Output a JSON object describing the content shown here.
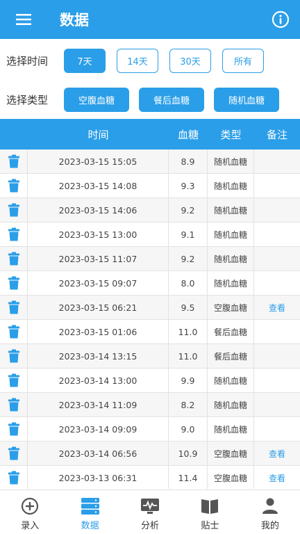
{
  "header": {
    "title": "数据"
  },
  "filters": {
    "time_label": "选择时间",
    "time_options": [
      "7天",
      "14天",
      "30天",
      "所有"
    ],
    "type_label": "选择类型",
    "type_options": [
      "空腹血糖",
      "餐后血糖",
      "随机血糖"
    ]
  },
  "table": {
    "columns": [
      "时间",
      "血糖",
      "类型",
      "备注"
    ],
    "rows": [
      {
        "time": "2023-03-15 15:05",
        "value": "8.9",
        "type": "随机血糖",
        "note": ""
      },
      {
        "time": "2023-03-15 14:08",
        "value": "9.3",
        "type": "随机血糖",
        "note": ""
      },
      {
        "time": "2023-03-15 14:06",
        "value": "9.2",
        "type": "随机血糖",
        "note": ""
      },
      {
        "time": "2023-03-15 13:00",
        "value": "9.1",
        "type": "随机血糖",
        "note": ""
      },
      {
        "time": "2023-03-15 11:07",
        "value": "9.2",
        "type": "随机血糖",
        "note": ""
      },
      {
        "time": "2023-03-15 09:07",
        "value": "8.0",
        "type": "随机血糖",
        "note": ""
      },
      {
        "time": "2023-03-15 06:21",
        "value": "9.5",
        "type": "空腹血糖",
        "note": "查看"
      },
      {
        "time": "2023-03-15 01:06",
        "value": "11.0",
        "type": "餐后血糖",
        "note": ""
      },
      {
        "time": "2023-03-14 13:15",
        "value": "11.0",
        "type": "餐后血糖",
        "note": ""
      },
      {
        "time": "2023-03-14 13:00",
        "value": "9.9",
        "type": "随机血糖",
        "note": ""
      },
      {
        "time": "2023-03-14 11:09",
        "value": "8.2",
        "type": "随机血糖",
        "note": ""
      },
      {
        "time": "2023-03-14 09:09",
        "value": "9.0",
        "type": "随机血糖",
        "note": ""
      },
      {
        "time": "2023-03-14 06:56",
        "value": "10.9",
        "type": "空腹血糖",
        "note": "查看"
      },
      {
        "time": "2023-03-13 06:31",
        "value": "11.4",
        "type": "空腹血糖",
        "note": "查看"
      }
    ]
  },
  "nav": {
    "items": [
      {
        "label": "录入",
        "icon": "plus-circle-icon"
      },
      {
        "label": "数据",
        "icon": "database-icon"
      },
      {
        "label": "分析",
        "icon": "analysis-icon"
      },
      {
        "label": "贴士",
        "icon": "book-icon"
      },
      {
        "label": "我的",
        "icon": "user-icon"
      }
    ]
  },
  "colors": {
    "accent": "#2a9ee8",
    "text": "#333333",
    "row_alt": "#f6f6f6"
  }
}
